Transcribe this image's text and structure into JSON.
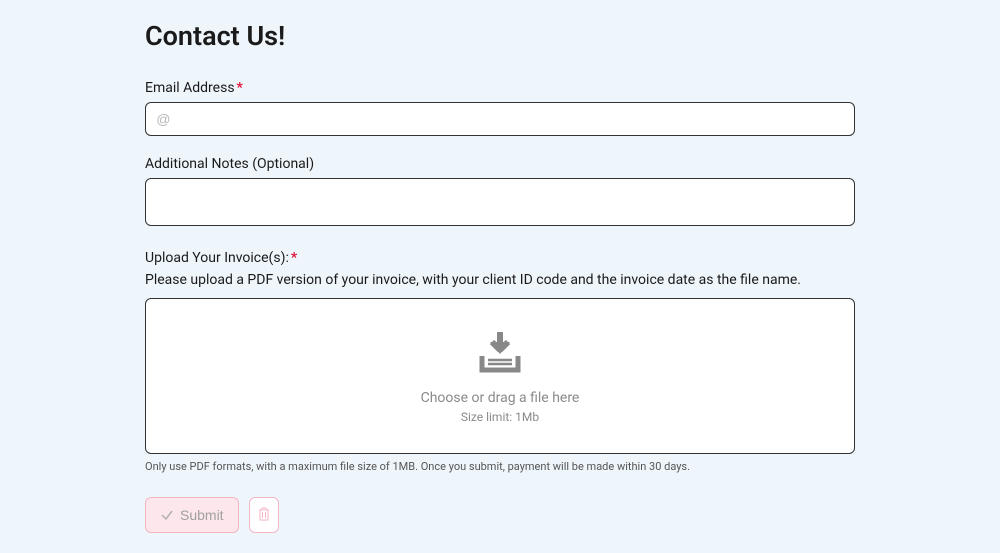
{
  "page": {
    "title": "Contact Us!"
  },
  "fields": {
    "email": {
      "label": "Email Address",
      "required": true,
      "placeholder": "@"
    },
    "notes": {
      "label": "Additional Notes (Optional)",
      "required": false
    },
    "upload": {
      "label": "Upload Your Invoice(s):",
      "required": true,
      "helper": "Please upload a PDF version of your invoice, with your client ID code and the invoice date as the file name.",
      "prompt": "Choose or drag a file here",
      "limit": "Size limit: 1Mb",
      "footer": "Only use PDF formats, with a maximum file size of 1MB. Once you submit, payment will be made within 30 days."
    }
  },
  "buttons": {
    "submit": "Submit"
  }
}
